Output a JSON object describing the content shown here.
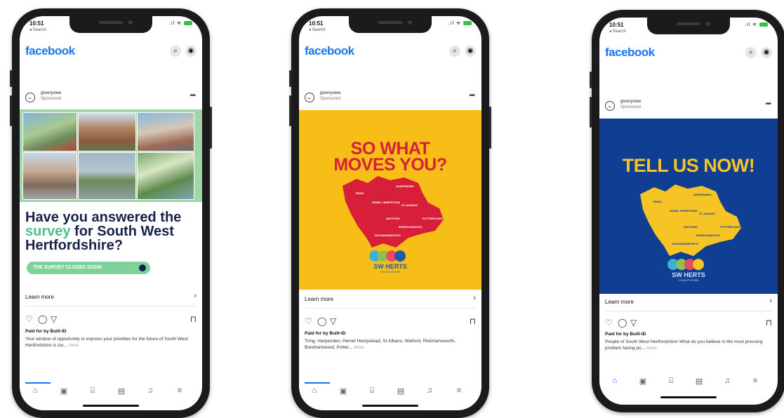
{
  "status": {
    "time": "10:51",
    "back": "◂ Search"
  },
  "app": {
    "logo": "facebook"
  },
  "advertiser": {
    "name": "givenyview",
    "sponsored": "Sponsored"
  },
  "cta": {
    "learn_more": "Learn more"
  },
  "paid_by": "Paid for by Built-ID",
  "more": "more",
  "colors": {
    "facebook_blue": "#1877f2",
    "survey_navy": "#17224d",
    "survey_green": "#4cc38a",
    "yellow": "#f7be17",
    "red": "#d81f3a",
    "blue": "#0f3e93"
  },
  "icons": [
    "search-icon",
    "messenger-icon",
    "heart-icon",
    "comment-icon",
    "share-icon",
    "bookmark-icon",
    "home-icon",
    "watch-icon",
    "marketplace-icon",
    "news-icon",
    "bell-icon",
    "menu-icon"
  ],
  "phones": [
    {
      "headline_pre": "Have you answered the ",
      "headline_highlight": "survey",
      "headline_post": " for South West Hertfordshire?",
      "button": "THE SURVEY CLOSES SOON",
      "description": "Your window of opportunity to express your priorities for the future of South West Hertfordshire is clo..."
    },
    {
      "headline_line1": "SO WHAT",
      "headline_line2": "MOVES YOU?",
      "map_labels": [
        "TRING",
        "HARPENDEN",
        "HEMEL HEMPSTEAD",
        "ST ALBANS",
        "WATFORD",
        "POTTERS BAR",
        "BOREHAMWOOD",
        "RICKMANSWORTH"
      ],
      "logo_text": "SW HERTS",
      "logo_sub": "YOUR FUTURE",
      "description": "Tring, Harpenden, Hemel Hempstead, St Albans, Watford, Rickmansworth, Borehamwood, Potter..."
    },
    {
      "headline": "TELL US NOW!",
      "map_labels": [
        "TRING",
        "HARPENDEN",
        "HEMEL HEMPSTEAD",
        "ST ALBANS",
        "WATFORD",
        "POTTERS BAR",
        "BOREHAMWOOD",
        "RICKMANSWORTH"
      ],
      "logo_text": "SW HERTS",
      "logo_sub": "YOUR FUTURE",
      "description": "People of South West Hertfordshire! What do you believe is the most pressing problem facing po..."
    }
  ]
}
